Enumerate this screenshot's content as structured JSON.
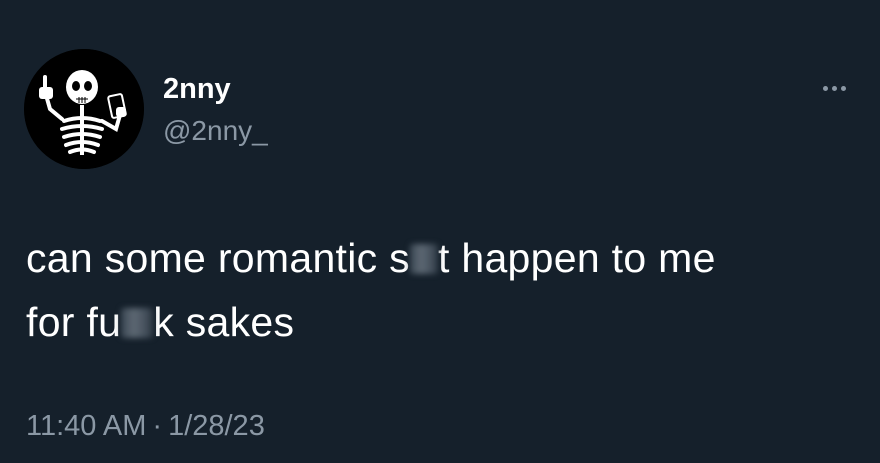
{
  "author": {
    "display_name": "2nny",
    "handle": "@2nny_",
    "avatar_icon": "skeleton-avatar-icon"
  },
  "menu": {
    "icon": "more-options-icon"
  },
  "tweet": {
    "line1_a": "can some romantic s",
    "line1_b": "t happen to me",
    "line2_a": "for fu",
    "line2_b": "k sakes"
  },
  "meta": {
    "time": "11:40 AM",
    "separator": "·",
    "date": "1/28/23"
  },
  "colors": {
    "background": "#15202b",
    "text": "#ffffff",
    "secondary": "#8b98a5"
  }
}
